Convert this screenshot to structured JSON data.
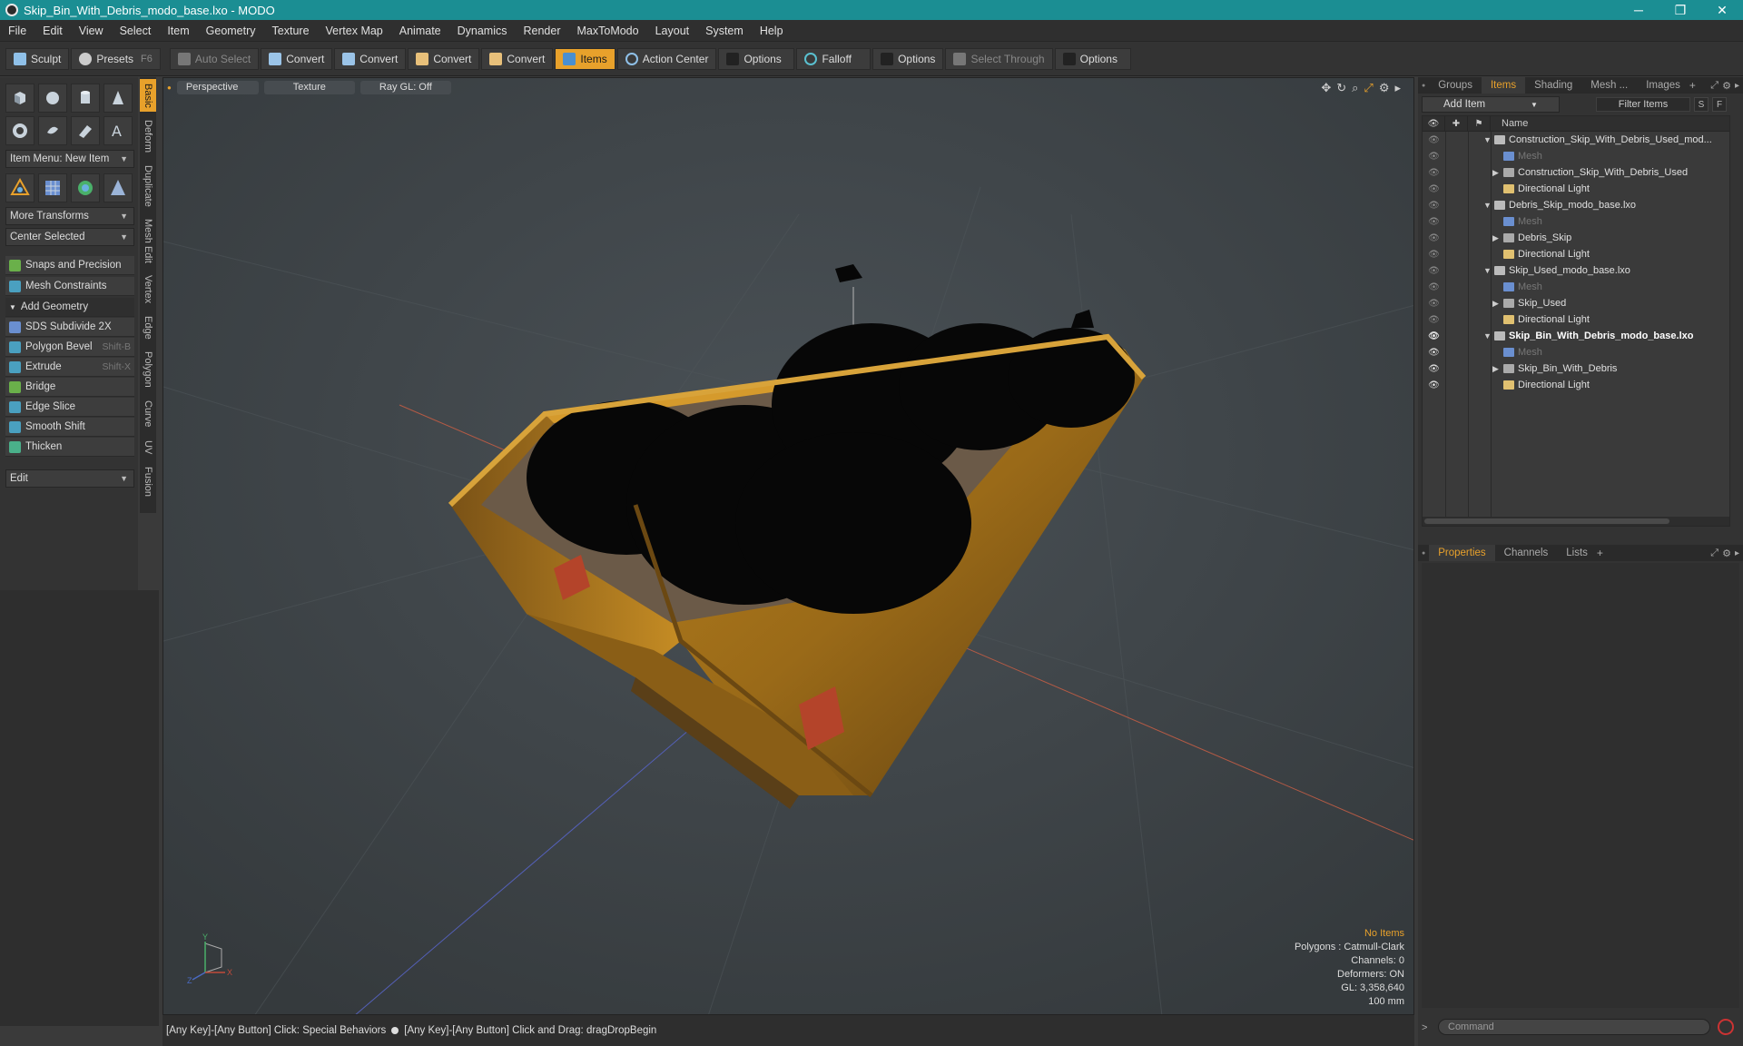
{
  "window": {
    "title": "Skip_Bin_With_Debris_modo_base.lxo - MODO",
    "buttons": [
      "─",
      "❐",
      "✕"
    ]
  },
  "menu": [
    "File",
    "Edit",
    "View",
    "Select",
    "Item",
    "Geometry",
    "Texture",
    "Vertex Map",
    "Animate",
    "Dynamics",
    "Render",
    "MaxToModo",
    "Layout",
    "System",
    "Help"
  ],
  "toolbar": {
    "sculpt": "Sculpt",
    "presets": "Presets",
    "presets_shortcut": "F6",
    "auto_select": "Auto Select",
    "convert1": "Convert",
    "convert2": "Convert",
    "convert3": "Convert",
    "convert4": "Convert",
    "items": "Items",
    "action_center": "Action Center",
    "options1": "Options",
    "falloff": "Falloff",
    "options2": "Options",
    "select_through": "Select Through",
    "options3": "Options"
  },
  "left": {
    "item_menu": "Item Menu: New Item",
    "more_transforms": "More Transforms",
    "center_selected": "Center Selected",
    "snaps": "Snaps and Precision",
    "mesh_constraints": "Mesh Constraints",
    "add_geometry": "Add Geometry",
    "tools": [
      {
        "label": "SDS Subdivide 2X",
        "shortcut": "",
        "color": "#6a8fd0"
      },
      {
        "label": "Polygon Bevel",
        "shortcut": "Shift-B",
        "color": "#4aa0c0"
      },
      {
        "label": "Extrude",
        "shortcut": "Shift-X",
        "color": "#4aa0c0"
      },
      {
        "label": "Bridge",
        "shortcut": "",
        "color": "#6ab04a"
      },
      {
        "label": "Edge Slice",
        "shortcut": "",
        "color": "#4aa0c0"
      },
      {
        "label": "Smooth Shift",
        "shortcut": "",
        "color": "#4aa0c0"
      },
      {
        "label": "Thicken",
        "shortcut": "",
        "color": "#4ab08a"
      }
    ],
    "edit_dropdown": "Edit",
    "vtabs": [
      "Basic",
      "Deform",
      "Duplicate",
      "Mesh Edit",
      "Vertex",
      "Edge",
      "Polygon",
      "Curve",
      "UV",
      "Fusion"
    ]
  },
  "viewport": {
    "perspective": "Perspective",
    "texture": "Texture",
    "raygl": "Ray GL: Off",
    "info": {
      "selection": "No Items",
      "polygons": "Polygons : Catmull-Clark",
      "channels": "Channels: 0",
      "deformers": "Deformers: ON",
      "gl": "GL: 3,358,640",
      "scale": "100 mm"
    },
    "axis_labels": {
      "y": "Y",
      "x": "X",
      "z": "Z"
    }
  },
  "status": {
    "left": "[Any Key]-[Any Button] Click: Special Behaviors",
    "right": "[Any Key]-[Any Button] Click and Drag: dragDropBegin"
  },
  "right": {
    "tabs": [
      "Groups",
      "Items",
      "Shading",
      "Mesh ...",
      "Images"
    ],
    "add_item": "Add Item",
    "filter": "Filter Items",
    "s_btn": "S",
    "f_btn": "F",
    "name_header": "Name",
    "items": [
      {
        "label": "Construction_Skip_With_Debris_Used_mod...",
        "level": 0,
        "tri": "▼",
        "kind": "scene"
      },
      {
        "label": "Mesh",
        "level": 1,
        "tri": "",
        "kind": "mesh"
      },
      {
        "label": "Construction_Skip_With_Debris_Used",
        "level": 1,
        "tri": "▶",
        "kind": "group"
      },
      {
        "label": "Directional Light",
        "level": 1,
        "tri": "",
        "kind": "light"
      },
      {
        "label": "Debris_Skip_modo_base.lxo",
        "level": 0,
        "tri": "▼",
        "kind": "scene"
      },
      {
        "label": "Mesh",
        "level": 1,
        "tri": "",
        "kind": "mesh"
      },
      {
        "label": "Debris_Skip",
        "level": 1,
        "tri": "▶",
        "kind": "group"
      },
      {
        "label": "Directional Light",
        "level": 1,
        "tri": "",
        "kind": "light"
      },
      {
        "label": "Skip_Used_modo_base.lxo",
        "level": 0,
        "tri": "▼",
        "kind": "scene"
      },
      {
        "label": "Mesh",
        "level": 1,
        "tri": "",
        "kind": "mesh"
      },
      {
        "label": "Skip_Used",
        "level": 1,
        "tri": "▶",
        "kind": "group"
      },
      {
        "label": "Directional Light",
        "level": 1,
        "tri": "",
        "kind": "light"
      },
      {
        "label": "Skip_Bin_With_Debris_modo_base.lxo",
        "level": 0,
        "tri": "▼",
        "kind": "scene-bold"
      },
      {
        "label": "Mesh",
        "level": 1,
        "tri": "",
        "kind": "mesh"
      },
      {
        "label": "Skip_Bin_With_Debris",
        "level": 1,
        "tri": "▶",
        "kind": "group"
      },
      {
        "label": "Directional Light",
        "level": 1,
        "tri": "",
        "kind": "light"
      }
    ],
    "prop_tabs": [
      "Properties",
      "Channels",
      "Lists"
    ],
    "command_placeholder": "Command"
  },
  "colors": {
    "accent": "#e8a12b",
    "titlebar": "#1b8e93"
  }
}
